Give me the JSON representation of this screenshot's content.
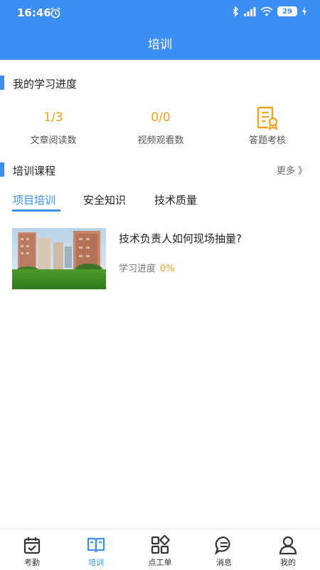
{
  "status_bar": {
    "time": "16:46",
    "battery": "29"
  },
  "header": {
    "title": "培训"
  },
  "progress_section": {
    "title": "我的学习进度",
    "stats": [
      {
        "value": "1/3",
        "label": "文章阅读数"
      },
      {
        "value": "0/0",
        "label": "视频观看数"
      },
      {
        "icon": "certificate-icon",
        "label": "答题考核"
      }
    ]
  },
  "courses_section": {
    "title": "培训课程",
    "more": "更多 》",
    "tabs": [
      "项目培训",
      "安全知识",
      "技术质量"
    ],
    "active_tab": "项目培训",
    "items": [
      {
        "title": "技术负责人如何现场抽量?",
        "progress_label": "学习进度",
        "progress_value": "0%"
      }
    ]
  },
  "bottom_nav": [
    {
      "label": "考勤",
      "icon": "calendar-check-icon"
    },
    {
      "label": "培训",
      "icon": "book-icon"
    },
    {
      "label": "点工单",
      "icon": "grid-apps-icon"
    },
    {
      "label": "消息",
      "icon": "message-icon"
    },
    {
      "label": "我的",
      "icon": "user-icon"
    }
  ],
  "colors": {
    "primary": "#3a8ef5",
    "accent": "#f0a21b"
  }
}
